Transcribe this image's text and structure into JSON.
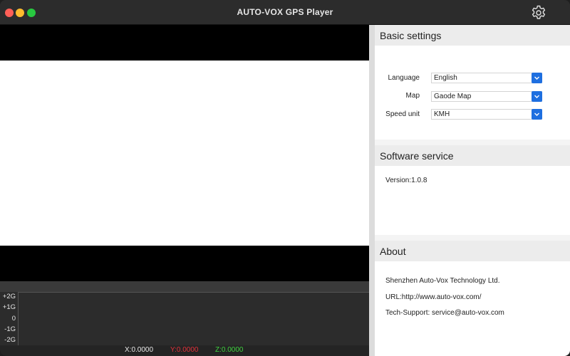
{
  "window": {
    "title": "AUTO-VOX GPS Player"
  },
  "gsensor": {
    "axis_labels": [
      "+2G",
      "+1G",
      "0",
      "-1G",
      "-2G"
    ],
    "x_value": "X:0.0000",
    "y_value": "Y:0.0000",
    "z_value": "Z:0.0000",
    "colors": {
      "x": "#e8e8e8",
      "y": "#e0313a",
      "z": "#3fd13f"
    }
  },
  "settings": {
    "basic_title": "Basic settings",
    "language": {
      "label": "Language",
      "value": "English"
    },
    "map": {
      "label": "Map",
      "value": "Gaode Map"
    },
    "speed_unit": {
      "label": "Speed unit",
      "value": "KMH"
    },
    "accent": "#1e6fe0"
  },
  "software": {
    "title": "Software service",
    "version": "Version:1.0.8"
  },
  "about": {
    "title": "About",
    "company": "Shenzhen Auto-Vox Technology Ltd.",
    "url": "URL:http://www.auto-vox.com/",
    "support": "Tech-Support: service@auto-vox.com"
  },
  "icons": [
    "close-button",
    "minimize-button",
    "maximize-button",
    "gear-icon",
    "chevron-down-icon"
  ]
}
